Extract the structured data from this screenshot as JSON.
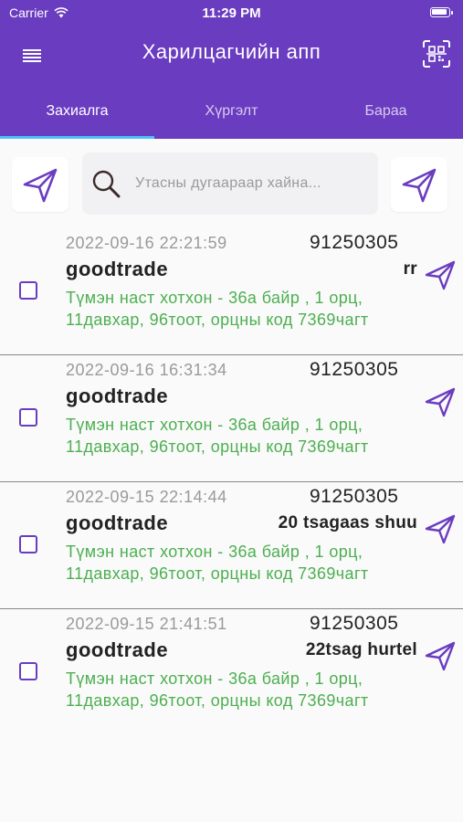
{
  "status_bar": {
    "carrier": "Carrier",
    "time": "11:29 PM"
  },
  "header": {
    "title": "Харилцагчийн апп"
  },
  "tabs": [
    {
      "label": "Захиалга",
      "active": true
    },
    {
      "label": "Хүргэлт",
      "active": false
    },
    {
      "label": "Бараа",
      "active": false
    }
  ],
  "search": {
    "placeholder": "Утасны дугаараар хайна..."
  },
  "colors": {
    "primary": "#6a3cc0",
    "address_green": "#4caf50",
    "tab_indicator": "#4fc3f7"
  },
  "orders": [
    {
      "date": "2022-09-16 22:21:59",
      "phone": "91250305",
      "company": "goodtrade",
      "note": "rr",
      "address": "Түмэн наст хотхон - 36а байр , 1 орц, 11давхар, 96тоот, орцны код 7369чагт"
    },
    {
      "date": "2022-09-16 16:31:34",
      "phone": "91250305",
      "company": "goodtrade",
      "note": "",
      "address": "Түмэн наст хотхон - 36а байр , 1 орц, 11давхар, 96тоот, орцны код 7369чагт"
    },
    {
      "date": "2022-09-15 22:14:44",
      "phone": "91250305",
      "company": "goodtrade",
      "note": "20 tsagaas shuu",
      "address": "Түмэн наст хотхон - 36а байр , 1 орц, 11давхар, 96тоот, орцны код 7369чагт"
    },
    {
      "date": "2022-09-15 21:41:51",
      "phone": "91250305",
      "company": "goodtrade",
      "note": "22tsag hurtel",
      "address": "Түмэн наст хотхон - 36а байр , 1 орц, 11давхар, 96тоот, орцны код 7369чагт"
    }
  ]
}
